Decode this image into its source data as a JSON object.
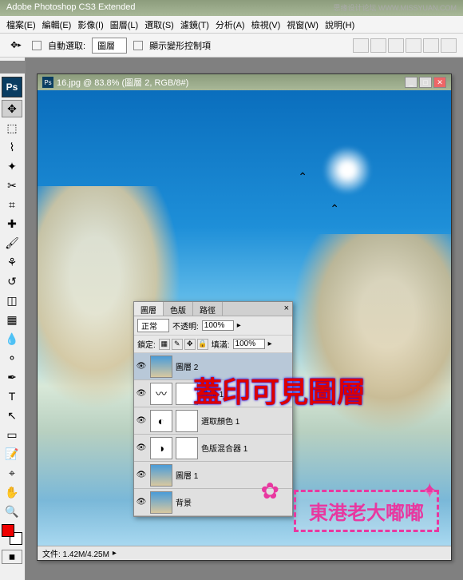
{
  "app": {
    "title": "Adobe Photoshop CS3 Extended",
    "watermark_top": "思缘设计论坛  WWW.MISSYUAN.COM"
  },
  "menu": {
    "file": "檔案(E)",
    "edit": "編輯(E)",
    "image": "影像(I)",
    "layer": "圖層(L)",
    "select": "選取(S)",
    "filter": "濾鏡(T)",
    "analysis": "分析(A)",
    "view": "檢視(V)",
    "window": "視窗(W)",
    "help": "說明(H)"
  },
  "options": {
    "auto_select": "自動選取:",
    "auto_select_value": "圖層",
    "transform_controls": "顯示變形控制項"
  },
  "document": {
    "title": "16.jpg @ 83.8% (圖層 2, RGB/8#)",
    "status": "文件: 1.42M/4.25M"
  },
  "layers_panel": {
    "tabs": {
      "layers": "圖層",
      "channels": "色版",
      "paths": "路徑"
    },
    "blend_mode": "正常",
    "opacity_label": "不透明:",
    "opacity_value": "100%",
    "lock_label": "鎖定:",
    "fill_label": "填滿:",
    "fill_value": "100%",
    "layers": [
      {
        "name": "圖層 2"
      },
      {
        "name": "曲線 1"
      },
      {
        "name": "選取顏色 1"
      },
      {
        "name": "色版混合器 1"
      },
      {
        "name": "圖層 1"
      },
      {
        "name": "背景"
      }
    ]
  },
  "overlay": {
    "main_text": "蓋印可見圖層",
    "stamp_text": "東港老大嘟嘟"
  }
}
